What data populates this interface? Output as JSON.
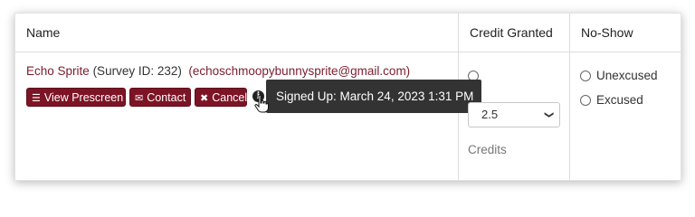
{
  "table": {
    "headers": {
      "name": "Name",
      "credit": "Credit Granted",
      "noshow": "No-Show"
    }
  },
  "row": {
    "participant_name": "Echo Sprite",
    "survey_id_text": "(Survey ID: 232)",
    "email_text": "(echoschmoopybunnysprite@gmail.com)",
    "buttons": {
      "view_prescreen": "View Prescreen",
      "contact": "Contact",
      "cancel": "Cancel"
    },
    "tooltip": "Signed Up: March 24, 2023 1:31 PM",
    "credit": {
      "selected_value": "2.5",
      "unit_label": "Credits"
    },
    "noshow": {
      "unexcused": "Unexcused",
      "excused": "Excused"
    }
  },
  "colors": {
    "brand": "#7d1426",
    "tooltip_bg": "#333333"
  }
}
